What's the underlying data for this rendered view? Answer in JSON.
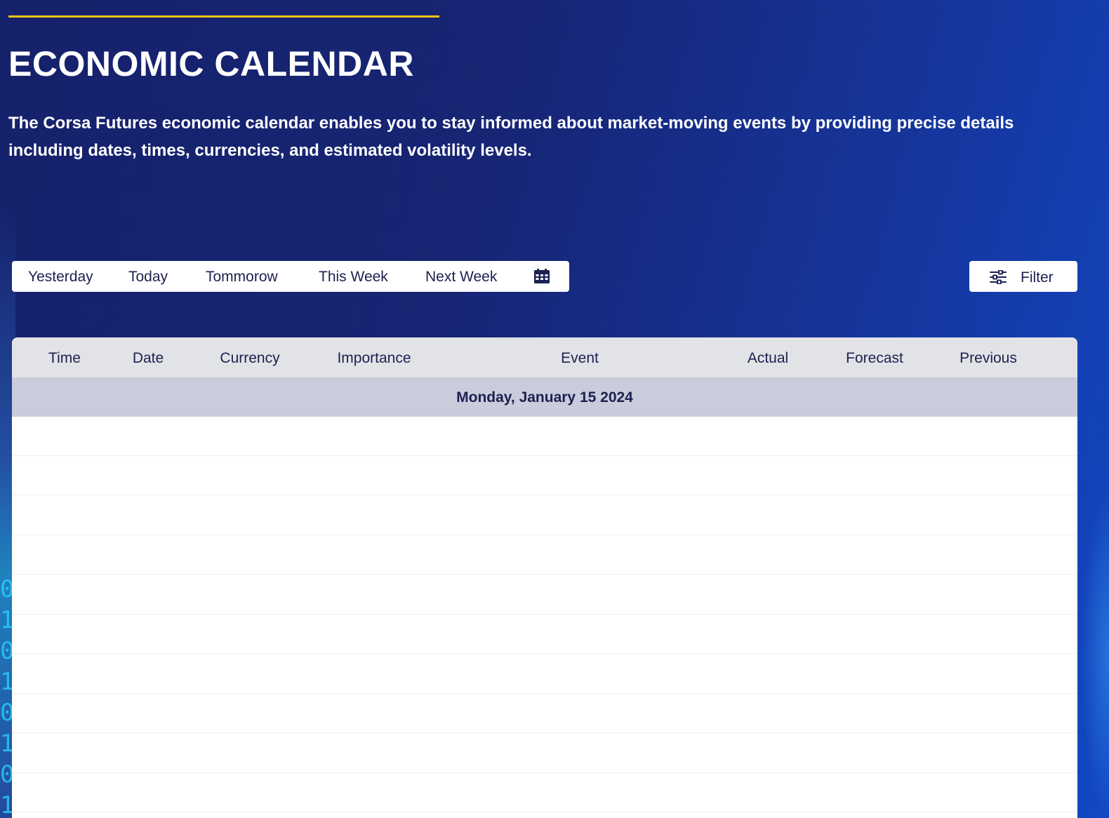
{
  "header": {
    "title": "ECONOMIC CALENDAR",
    "description": "The Corsa Futures economic calendar enables you to stay informed about market-moving events by providing precise details including dates, times, currencies, and estimated volatility levels."
  },
  "range_selector": {
    "items": [
      "Yesterday",
      "Today",
      "Tommorow",
      "This Week",
      "Next Week"
    ],
    "calendar_icon": "calendar-icon"
  },
  "filter": {
    "label": "Filter",
    "icon": "sliders-icon"
  },
  "table": {
    "columns": [
      "Time",
      "Date",
      "Currency",
      "Importance",
      "Event",
      "Actual",
      "Forecast",
      "Previous"
    ],
    "groups": [
      {
        "date_label": "Monday, January 15 2024",
        "rows": []
      }
    ]
  },
  "colors": {
    "accent_line": "#f5c518",
    "background": "#16216b",
    "text_dark": "#1b2150",
    "table_header_bg": "#e2e3e6",
    "date_row_bg": "#cacbdb"
  }
}
